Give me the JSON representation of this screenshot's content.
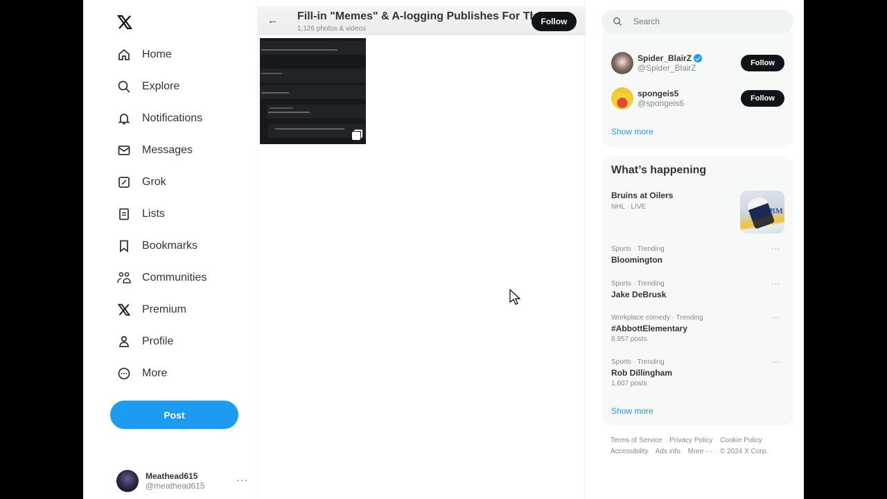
{
  "nav": {
    "logo": "x-logo",
    "items": [
      {
        "label": "Home",
        "icon": "home-icon"
      },
      {
        "label": "Explore",
        "icon": "search-icon"
      },
      {
        "label": "Notifications",
        "icon": "bell-icon"
      },
      {
        "label": "Messages",
        "icon": "envelope-icon"
      },
      {
        "label": "Grok",
        "icon": "grok-icon"
      },
      {
        "label": "Lists",
        "icon": "list-icon"
      },
      {
        "label": "Bookmarks",
        "icon": "bookmark-icon"
      },
      {
        "label": "Communities",
        "icon": "communities-icon"
      },
      {
        "label": "Premium",
        "icon": "x-icon"
      },
      {
        "label": "Profile",
        "icon": "person-icon"
      },
      {
        "label": "More",
        "icon": "more-circle-icon"
      }
    ],
    "post_label": "Post",
    "account": {
      "name": "Meathead615",
      "handle": "@meathead615",
      "more": "···"
    }
  },
  "main": {
    "title": "Fill-in \"Memes\" & A-logging Publishes For Th",
    "subtitle": "1,126 photos & videos",
    "follow_label": "Follow",
    "back_icon": "←"
  },
  "right": {
    "search_placeholder": "Search",
    "who_to_follow": [
      {
        "name": "Spider_BlairZ",
        "handle": "@Spider_BlairZ",
        "verified": true,
        "follow_label": "Follow"
      },
      {
        "name": "spongeis5",
        "handle": "@spongeis6",
        "verified": false,
        "follow_label": "Follow"
      }
    ],
    "show_more": "Show more",
    "trends_title": "What’s happening",
    "featured": {
      "title": "Bruins at Oilers",
      "context": "NHL · LIVE",
      "image_text": "BM"
    },
    "trends": [
      {
        "context": "Sports · Trending",
        "title": "Bloomington",
        "count": ""
      },
      {
        "context": "Sports · Trending",
        "title": "Jake DeBrusk",
        "count": ""
      },
      {
        "context": "Workplace comedy · Trending",
        "title": "#AbbottElementary",
        "count": "8,957 posts"
      },
      {
        "context": "Sports · Trending",
        "title": "Rob Dillingham",
        "count": "1,607 posts"
      }
    ],
    "trend_more": "···",
    "trends_show_more": "Show more",
    "footer": [
      "Terms of Service",
      "Privacy Policy",
      "Cookie Policy",
      "Accessibility",
      "Ads info",
      "More ···",
      "© 2024 X Corp."
    ]
  }
}
